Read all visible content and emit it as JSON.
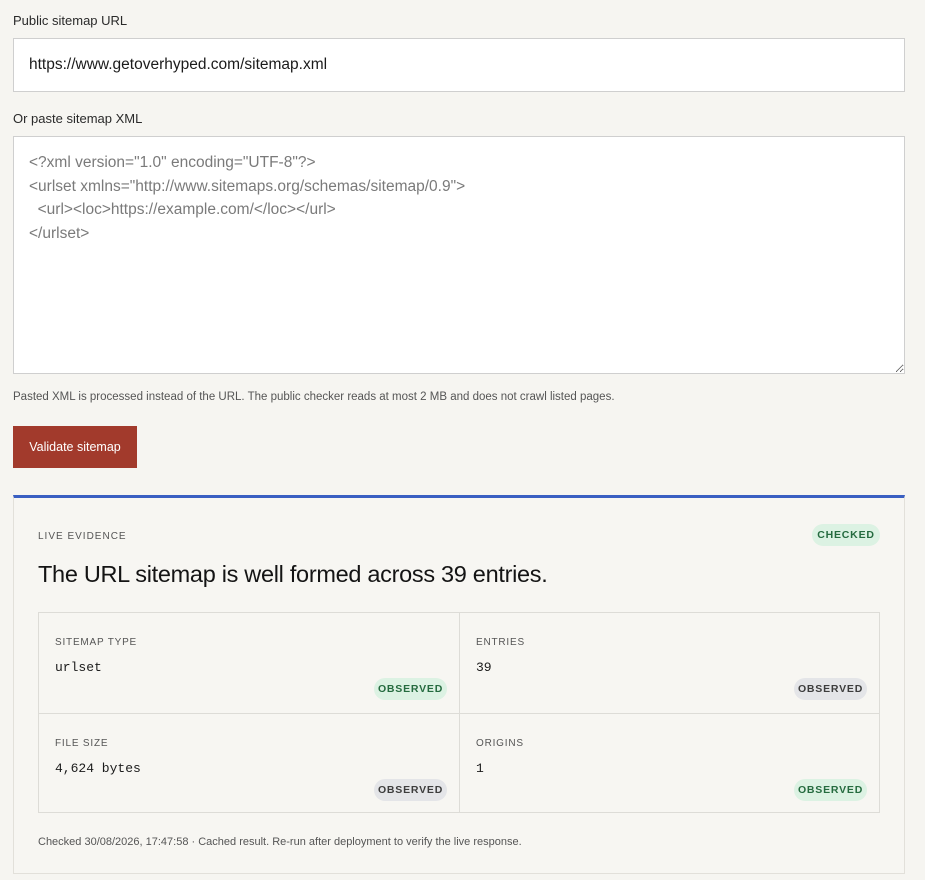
{
  "form": {
    "url_label": "Public sitemap URL",
    "url_value": "https://www.getoverhyped.com/sitemap.xml",
    "xml_label": "Or paste sitemap XML",
    "xml_placeholder": "<?xml version=\"1.0\" encoding=\"UTF-8\"?>\n<urlset xmlns=\"http://www.sitemaps.org/schemas/sitemap/0.9\">\n  <url><loc>https://example.com/</loc></url>\n</urlset>",
    "hint": "Pasted XML is processed instead of the URL. The public checker reads at most 2 MB and does not crawl listed pages.",
    "validate_label": "Validate sitemap"
  },
  "evidence": {
    "kicker": "LIVE EVIDENCE",
    "status": "CHECKED",
    "title": "The URL sitemap is well formed across 39 entries.",
    "cells": [
      {
        "label": "SITEMAP TYPE",
        "value": "urlset",
        "badge": "OBSERVED",
        "badge_tone": "green"
      },
      {
        "label": "ENTRIES",
        "value": "39",
        "badge": "OBSERVED",
        "badge_tone": "gray"
      },
      {
        "label": "FILE SIZE",
        "value": "4,624 bytes",
        "badge": "OBSERVED",
        "badge_tone": "gray"
      },
      {
        "label": "ORIGINS",
        "value": "1",
        "badge": "OBSERVED",
        "badge_tone": "green"
      }
    ],
    "footer": "Checked 30/08/2026, 17:47:58 · Cached result. Re-run after deployment to verify the live response."
  },
  "colors": {
    "accent_button": "#a23a2c",
    "evidence_border": "#3a5fc2",
    "badge_green_bg": "#dcf2e3",
    "badge_green_text": "#256b3f",
    "badge_gray_bg": "#e4e5e8"
  }
}
